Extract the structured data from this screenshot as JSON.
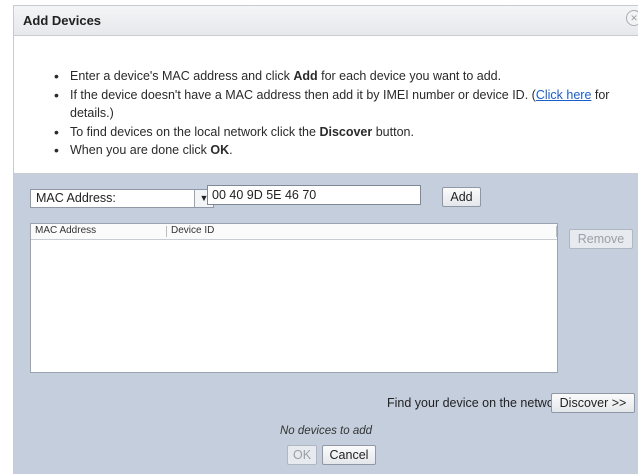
{
  "dialog": {
    "title": "Add Devices"
  },
  "instructions": {
    "line1_pre": "Enter a device's MAC address and click ",
    "line1_bold": "Add",
    "line1_post": " for each device you want to add.",
    "line2_pre": "If the device doesn't have a MAC address then add it by IMEI number or device ID. (",
    "line2_link": "Click here",
    "line2_post": " for details.)",
    "line3_pre": "To find devices on the local network click the ",
    "line3_bold": "Discover",
    "line3_post": " button.",
    "line4_pre": "When you are done click ",
    "line4_bold": "OK",
    "line4_post": "."
  },
  "form": {
    "id_type_selected": "MAC Address:",
    "mac_value": "00 40 9D 5E 46 70",
    "add_label": "Add"
  },
  "device_table": {
    "columns": [
      "MAC Address",
      "Device ID"
    ],
    "rows": []
  },
  "actions": {
    "remove_label": "Remove",
    "find_text": "Find your device on the network.",
    "discover_label": "Discover >>",
    "status_text": "No devices to add",
    "ok_label": "OK",
    "cancel_label": "Cancel"
  }
}
